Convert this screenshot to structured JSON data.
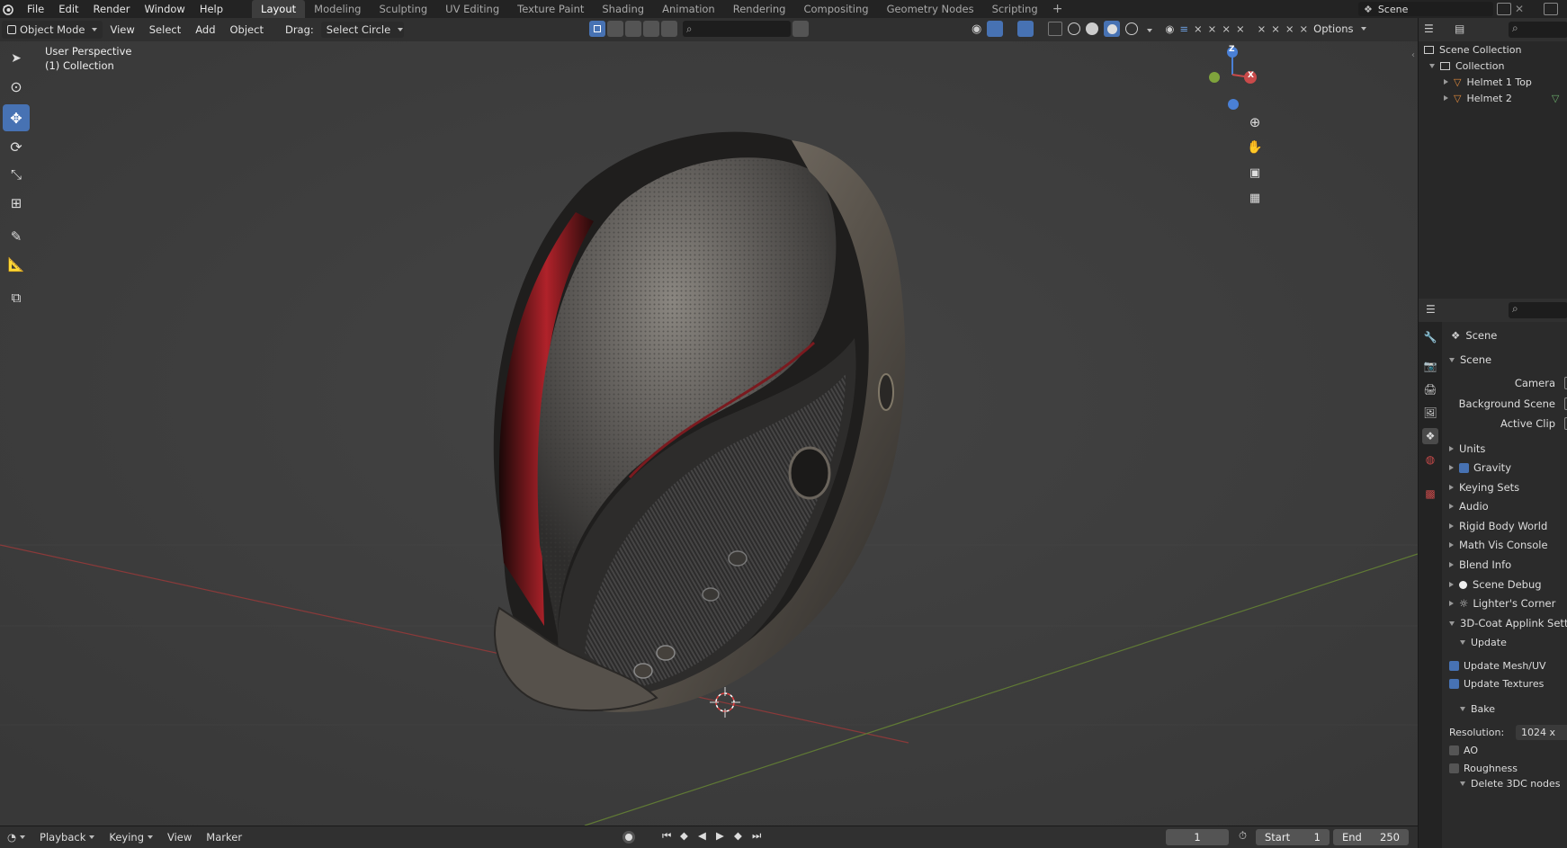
{
  "menubar": {
    "items": [
      "File",
      "Edit",
      "Render",
      "Window",
      "Help"
    ],
    "workspaces": [
      "Layout",
      "Modeling",
      "Sculpting",
      "UV Editing",
      "Texture Paint",
      "Shading",
      "Animation",
      "Rendering",
      "Compositing",
      "Geometry Nodes",
      "Scripting"
    ],
    "active_workspace": "Layout",
    "add_tab": "+",
    "scene_name": "Scene"
  },
  "header": {
    "mode": "Object Mode",
    "menus": [
      "View",
      "Select",
      "Add",
      "Object"
    ],
    "drag_label": "Drag:",
    "drag_value": "Select Circle",
    "options": "Options"
  },
  "viewport": {
    "title": "User Perspective",
    "subtitle": "(1) Collection",
    "gizmo_z": "Z",
    "gizmo_x": "X"
  },
  "outliner": {
    "root": "Scene Collection",
    "collection": "Collection",
    "objects": [
      "Helmet 1 Top",
      "Helmet 2"
    ]
  },
  "properties": {
    "context": "Scene",
    "panel_scene": "Scene",
    "fields": [
      "Camera",
      "Background Scene",
      "Active Clip"
    ],
    "panels": [
      "Units",
      "Gravity",
      "Keying Sets",
      "Audio",
      "Rigid Body World",
      "Math Vis Console",
      "Blend Info",
      "Scene Debug",
      "Lighter's Corner",
      "3D-Coat Applink Sett"
    ],
    "update_panel": "Update",
    "update_mesh": "Update Mesh/UV",
    "update_textures": "Update Textures",
    "bake_panel": "Bake",
    "resolution_label": "Resolution:",
    "resolution_value": "1024 x",
    "ao": "AO",
    "roughness": "Roughness",
    "cut_off": "Delete 3DC nodes"
  },
  "timeline": {
    "playback": "Playback",
    "keying": "Keying",
    "view": "View",
    "marker": "Marker",
    "current_frame": "1",
    "start_label": "Start",
    "start_value": "1",
    "end_label": "End",
    "end_value": "250"
  },
  "colors": {
    "accent": "#4772b3",
    "x_axis": "#c94a4a",
    "y_axis": "#7fa33c",
    "z_axis": "#4a80d6"
  }
}
